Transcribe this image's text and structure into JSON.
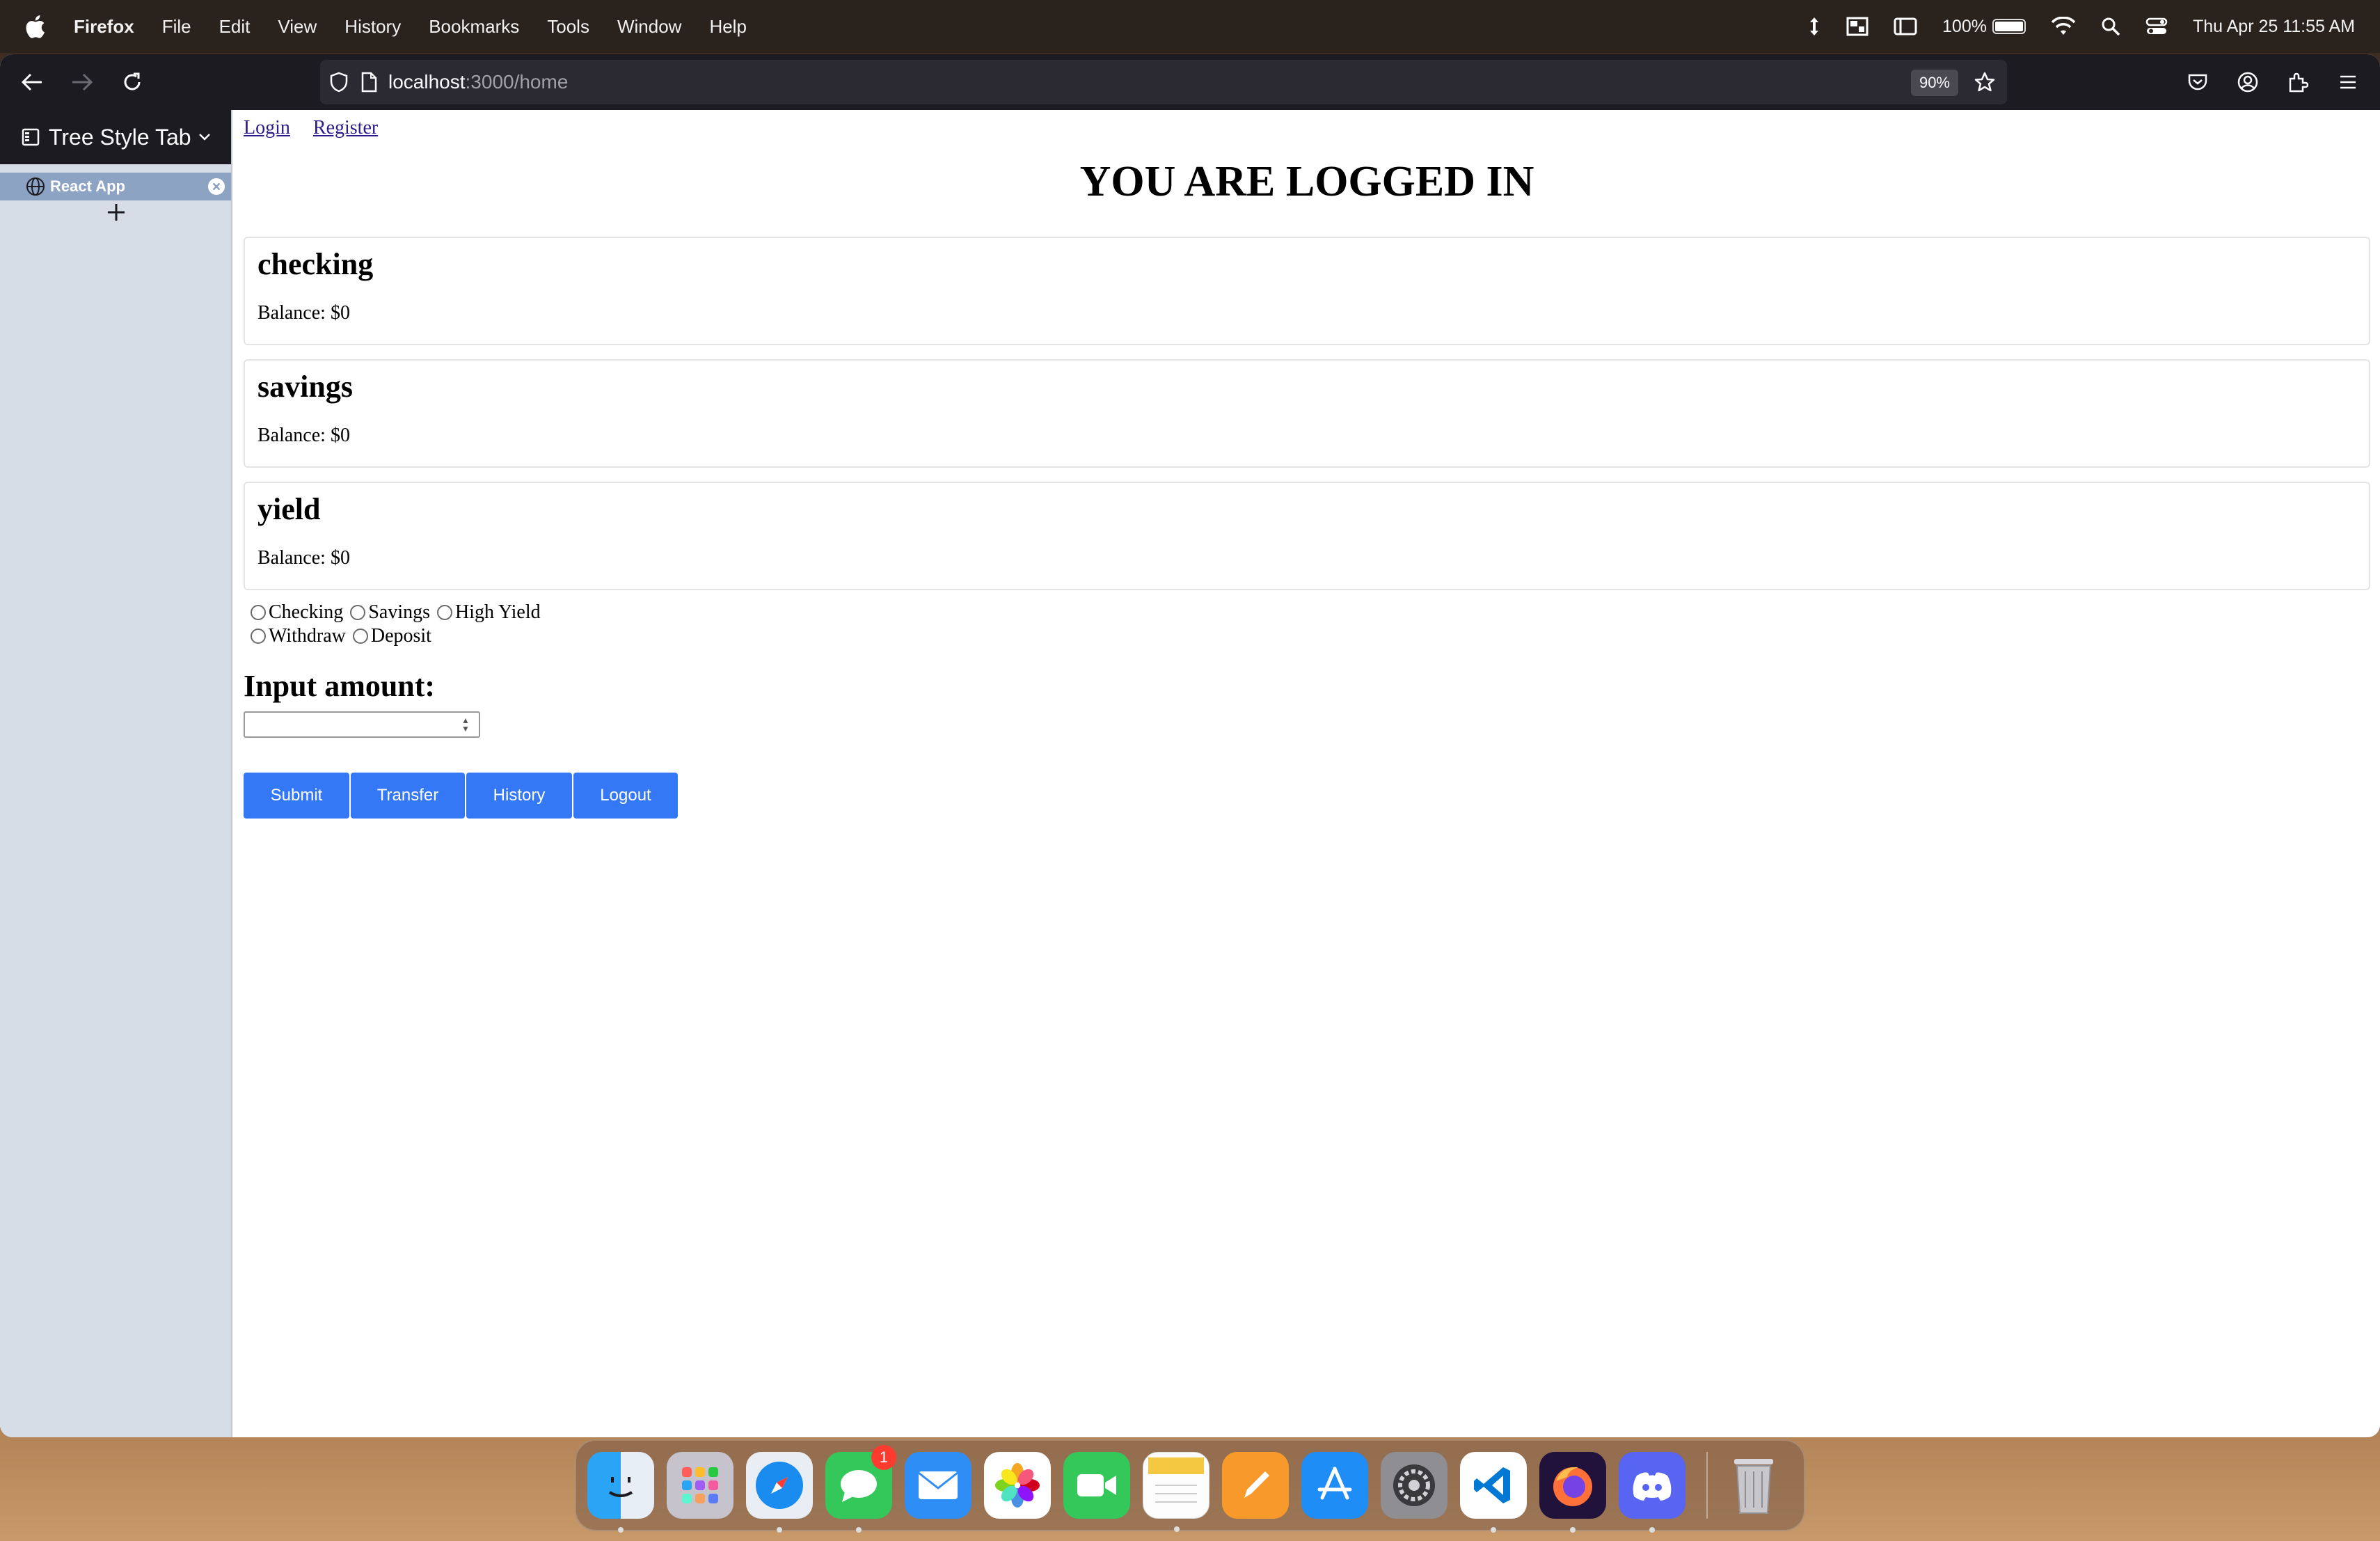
{
  "menubar": {
    "app": "Firefox",
    "items": [
      "File",
      "Edit",
      "View",
      "History",
      "Bookmarks",
      "Tools",
      "Window",
      "Help"
    ],
    "battery": "100%",
    "clock": "Thu Apr 25  11:55 AM"
  },
  "browser": {
    "url_host": "localhost",
    "url_rest": ":3000/home",
    "zoom": "90%"
  },
  "sidebar": {
    "title": "Tree Style Tab",
    "tab_label": "React App"
  },
  "page": {
    "nav": {
      "login": "Login",
      "register": "Register"
    },
    "title": "YOU ARE LOGGED IN",
    "accounts": [
      {
        "name": "checking",
        "balance": "Balance: $0"
      },
      {
        "name": "savings",
        "balance": "Balance: $0"
      },
      {
        "name": "yield",
        "balance": "Balance: $0"
      }
    ],
    "account_options": [
      "Checking",
      "Savings",
      "High Yield"
    ],
    "action_options": [
      "Withdraw",
      "Deposit"
    ],
    "input_label": "Input amount:",
    "input_value": "",
    "buttons": {
      "submit": "Submit",
      "transfer": "Transfer",
      "history": "History",
      "logout": "Logout"
    }
  },
  "dock": {
    "apps": [
      "finder-icon",
      "launchpad-icon",
      "safari-icon",
      "messages-icon",
      "mail-icon",
      "photos-icon",
      "facetime-icon",
      "notes-icon",
      "pages-icon",
      "app-store-icon",
      "system-settings-icon",
      "vscode-icon",
      "firefox-icon",
      "discord-icon"
    ],
    "messages_badge": "1"
  },
  "colors": {
    "accent_button": "#3478f6",
    "sidebar_bg": "#d7dde6",
    "selected_tab": "#8da3c4",
    "toolbar_bg": "#1c1b22"
  }
}
